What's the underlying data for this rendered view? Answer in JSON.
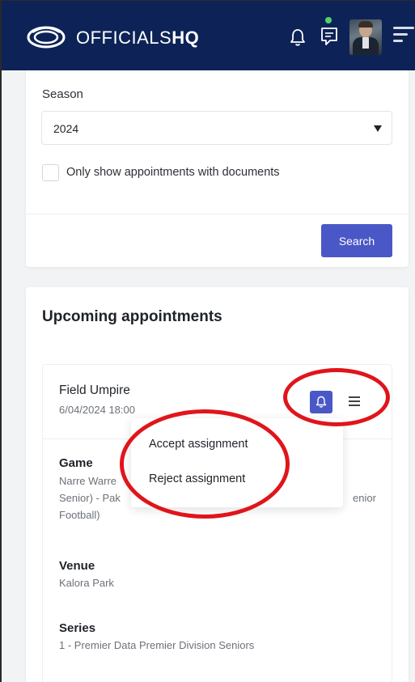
{
  "header": {
    "brand_light": "OFFICIALS",
    "brand_bold": "HQ",
    "icons": [
      "football-logo-icon",
      "bell-icon",
      "chat-icon",
      "avatar",
      "menu-icon"
    ],
    "background_color": "#0d2357"
  },
  "filters": {
    "season_label": "Season",
    "season_value": "2024",
    "documents_checkbox_label": "Only show appointments with documents",
    "documents_checked": false,
    "search_button_label": "Search",
    "accent_color": "#4a58c7"
  },
  "appointments": {
    "title": "Upcoming appointments",
    "item": {
      "role": "Field Umpire",
      "datetime": "6/04/2024 18:00",
      "game_label": "Game",
      "game_line1": "Narre Warre",
      "game_line2": "Senior) - Pak",
      "game_line2_tail": "enior",
      "game_line3": "Football)",
      "venue_label": "Venue",
      "venue_value": "Kalora Park",
      "series_label": "Series",
      "series_value": "1 - Premier Data Premier Division Seniors"
    }
  },
  "dropdown": {
    "options": [
      "Accept assignment",
      "Reject assignment"
    ]
  },
  "annotation_color": "#e0151b"
}
